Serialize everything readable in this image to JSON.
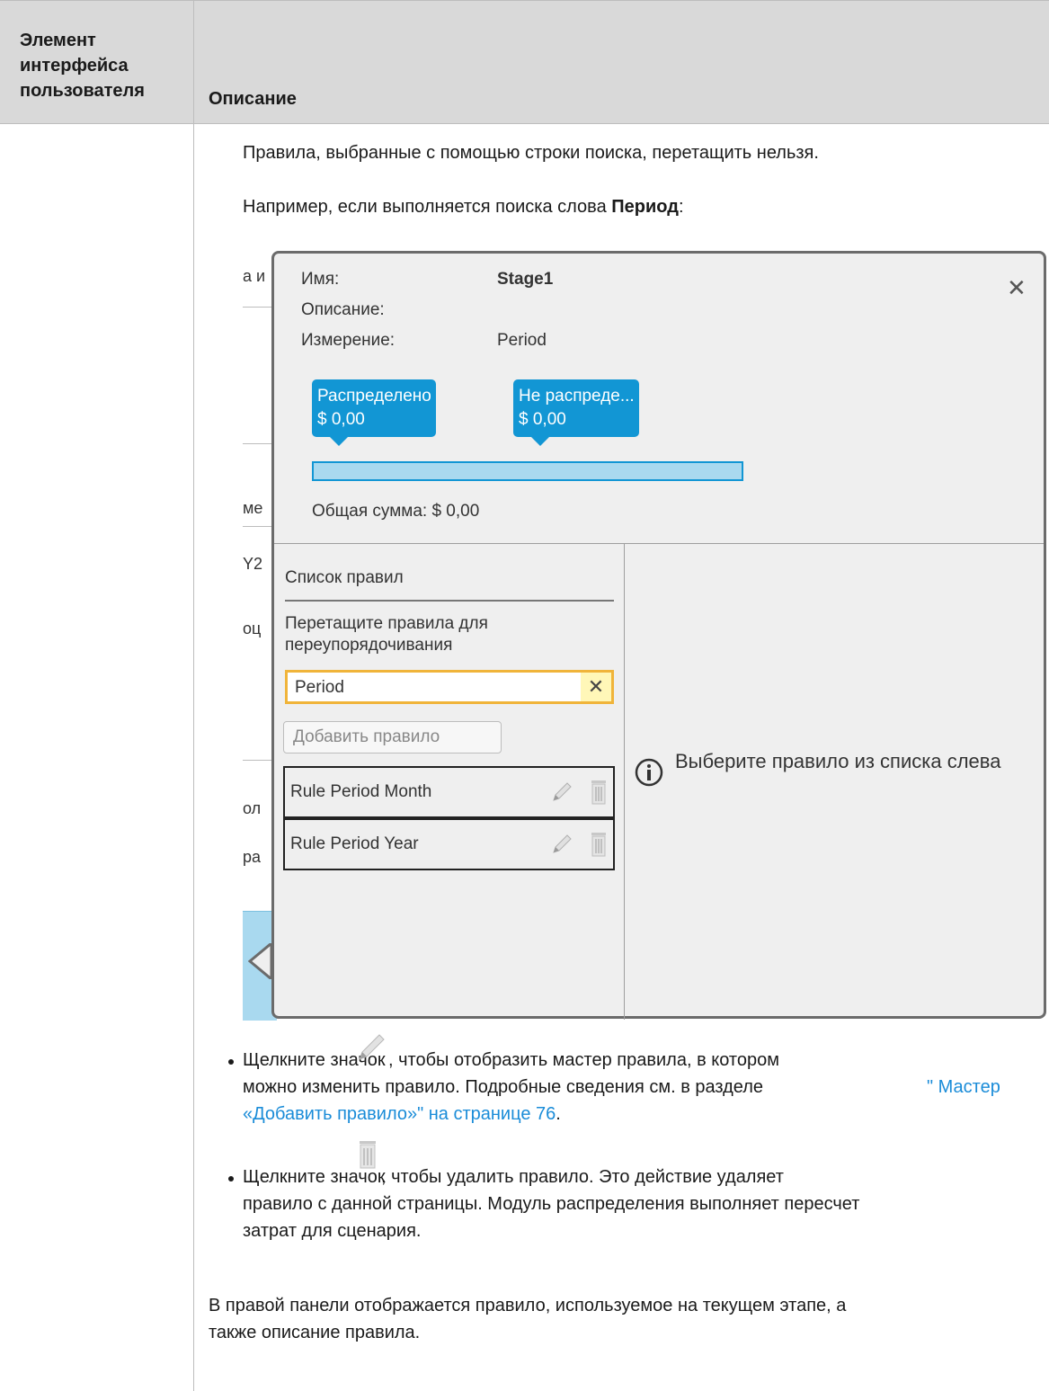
{
  "header": {
    "col1_title": "Элемент интерфейса пользователя",
    "col2_title": "Описание"
  },
  "body": {
    "para1": "Правила, выбранные с помощью строки поиска, перетащить нельзя.",
    "para2_prefix": "Например, если выполняется поиска слова ",
    "para2_bold": "Период",
    "para2_suffix": ":",
    "bullet1_a": "Щелкните значок",
    "bullet1_b": ", чтобы отобразить мастер правила, в котором",
    "bullet1_c": "можно изменить правило. Подробные сведения см. в разделе ",
    "bullet1_link_a": "\" Мастер",
    "bullet1_link_b": "«Добавить правило»\" на странице 76",
    "bullet1_end": ".",
    "bullet2_a": "Щелкните значок",
    "bullet2_b": ", чтобы удалить правило. Это действие удаляет",
    "bullet2_c": "правило с данной страницы. Модуль распределения выполняет пересчет",
    "bullet2_d": "затрат для сценария.",
    "final_a": "В правой панели отображается правило, используемое на текущем этапе, а",
    "final_b": "также описание правила."
  },
  "screenshot": {
    "bg_fragments": [
      "а и",
      "ме",
      "Y2",
      "оц",
      "ол",
      "ра"
    ],
    "name_label": "Имя:",
    "name_value": "Stage1",
    "desc_label": "Описание:",
    "dim_label": "Измерение:",
    "dim_value": "Period",
    "callout1_title": "Распределено",
    "callout1_value": "$ 0,00",
    "callout2_title": "Не распреде...",
    "callout2_value": "$ 0,00",
    "total": "Общая сумма: $ 0,00",
    "rules_title": "Список правил",
    "drag_hint_1": "Перетащите правила для",
    "drag_hint_2": "переупорядочивания",
    "search_value": "Period",
    "add_rule": "Добавить правило",
    "rules": [
      "Rule Period Month",
      "Rule Period Year"
    ],
    "info_text": "Выберите правило из списка слева",
    "colors": {
      "accent": "#1296d4",
      "search_border": "#f0b43a",
      "bar_fill": "#a9d9ef",
      "link": "#1a8cd8"
    }
  }
}
